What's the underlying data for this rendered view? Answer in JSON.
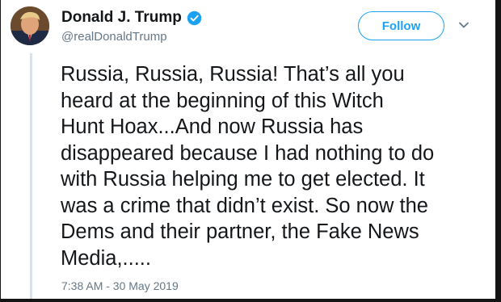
{
  "tweet": {
    "display_name": "Donald J. Trump",
    "handle": "@realDonaldTrump",
    "verified": true,
    "follow_label": "Follow",
    "text": "Russia, Russia, Russia! That’s all you\nheard at the beginning of this Witch\nHunt Hoax...And now Russia has\ndisappeared because I had nothing to do\nwith Russia helping me to get elected. It\nwas a crime that didn’t exist. So now the\nDems and their partner, the Fake News\nMedia,.....",
    "timestamp": "7:38 AM - 30 May 2019"
  },
  "icons": {
    "verified": "verified-badge-icon",
    "more": "chevron-down-icon"
  },
  "colors": {
    "accent": "#1da1f2",
    "text": "#14171a",
    "muted": "#657786",
    "thread_rule": "#cfe5f3"
  }
}
